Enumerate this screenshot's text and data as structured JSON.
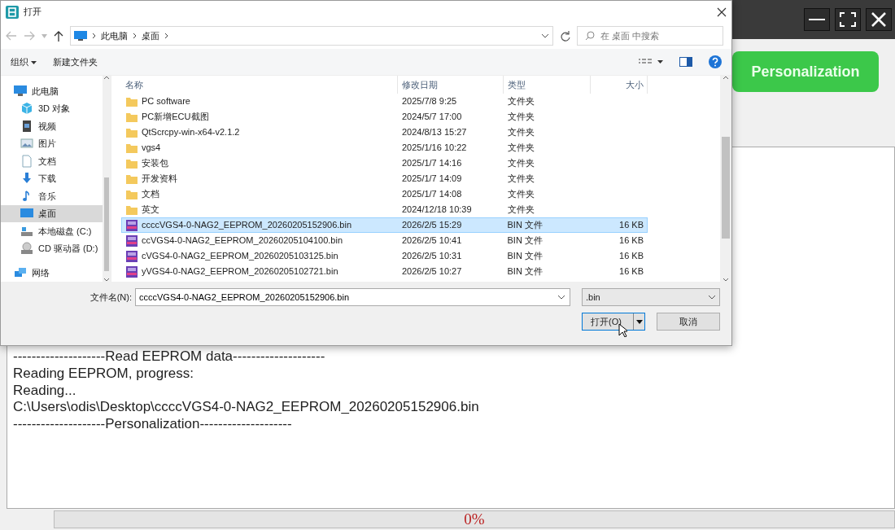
{
  "app": {
    "action_button": "Personalization",
    "log_lines": [
      "--------------------Read EEPROM data--------------------",
      "Reading EEPROM, progress:",
      "Reading...",
      "C:\\Users\\odis\\Desktop\\ccccVGS4-0-NAG2_EEPROM_20260205152906.bin",
      "--------------------Personalization--------------------"
    ],
    "progress": {
      "level": 0,
      "reading": "0%"
    }
  },
  "dialog": {
    "title": "打开",
    "breadcrumb": [
      "此电脑",
      "桌面"
    ],
    "search": {
      "placeholder": "在 桌面 中搜索"
    },
    "toolbar": [
      {
        "label": "组织",
        "kind": "menu"
      },
      {
        "label": "新建文件夹",
        "kind": "plain"
      }
    ],
    "nav": [
      {
        "label": "此电脑",
        "kind": "computer",
        "selected": false,
        "children": [
          {
            "label": "3D 对象",
            "kind": "cube",
            "selected": false
          },
          {
            "label": "视频",
            "kind": "video",
            "selected": false
          },
          {
            "label": "图片",
            "kind": "picture",
            "selected": false
          },
          {
            "label": "文档",
            "kind": "document",
            "selected": false
          },
          {
            "label": "下载",
            "kind": "download",
            "selected": false
          },
          {
            "label": "音乐",
            "kind": "music",
            "selected": false
          },
          {
            "label": "桌面",
            "kind": "desktop",
            "selected": true
          },
          {
            "label": "本地磁盘 (C:)",
            "kind": "disk",
            "selected": false
          },
          {
            "label": "CD 驱动器 (D:)",
            "kind": "cd",
            "selected": false
          }
        ]
      },
      {
        "label": "网络",
        "kind": "network",
        "selected": false
      }
    ],
    "columns": [
      "名称",
      "修改日期",
      "类型",
      "大小"
    ],
    "files": [
      {
        "kind": "folder",
        "name": "PC software",
        "date": "2025/7/8 9:25",
        "type": "文件夹",
        "selected": false
      },
      {
        "kind": "folder",
        "name": "PC新增ECU截图",
        "date": "2024/5/7 17:00",
        "type": "文件夹",
        "selected": false
      },
      {
        "kind": "folder",
        "name": "QtScrcpy-win-x64-v2.1.2",
        "date": "2024/8/13 15:27",
        "type": "文件夹",
        "selected": false
      },
      {
        "kind": "folder",
        "name": "vgs4",
        "date": "2025/1/16 10:22",
        "type": "文件夹",
        "selected": false
      },
      {
        "kind": "folder",
        "name": "安装包",
        "date": "2025/1/7 14:16",
        "type": "文件夹",
        "selected": false
      },
      {
        "kind": "folder",
        "name": "开发资料",
        "date": "2025/1/7 14:09",
        "type": "文件夹",
        "selected": false
      },
      {
        "kind": "folder",
        "name": "文档",
        "date": "2025/1/7 14:08",
        "type": "文件夹",
        "selected": false
      },
      {
        "kind": "folder",
        "name": "英文",
        "date": "2024/12/18 10:39",
        "type": "文件夹",
        "selected": false
      },
      {
        "kind": "file",
        "name": "ccccVGS4-0-NAG2_EEPROM_20260205152906.bin",
        "date": "2026/2/5 15:29",
        "type": "BIN 文件",
        "size": "16 KB",
        "selected": true
      },
      {
        "kind": "file",
        "name": "ccVGS4-0-NAG2_EEPROM_20260205104100.bin",
        "date": "2026/2/5 10:41",
        "type": "BIN 文件",
        "size": "16 KB",
        "selected": false
      },
      {
        "kind": "file",
        "name": "cVGS4-0-NAG2_EEPROM_20260205103125.bin",
        "date": "2026/2/5 10:31",
        "type": "BIN 文件",
        "size": "16 KB",
        "selected": false
      },
      {
        "kind": "file",
        "name": "yVGS4-0-NAG2_EEPROM_20260205102721.bin",
        "date": "2026/2/5 10:27",
        "type": "BIN 文件",
        "size": "16 KB",
        "selected": false
      }
    ],
    "filename_label": "文件名(N):",
    "filename": "ccccVGS4-0-NAG2_EEPROM_20260205152906.bin",
    "filter": ".bin",
    "buttons": [
      {
        "label": "打开(O)",
        "kind": "split"
      },
      {
        "label": "取消",
        "kind": "plain"
      }
    ]
  }
}
